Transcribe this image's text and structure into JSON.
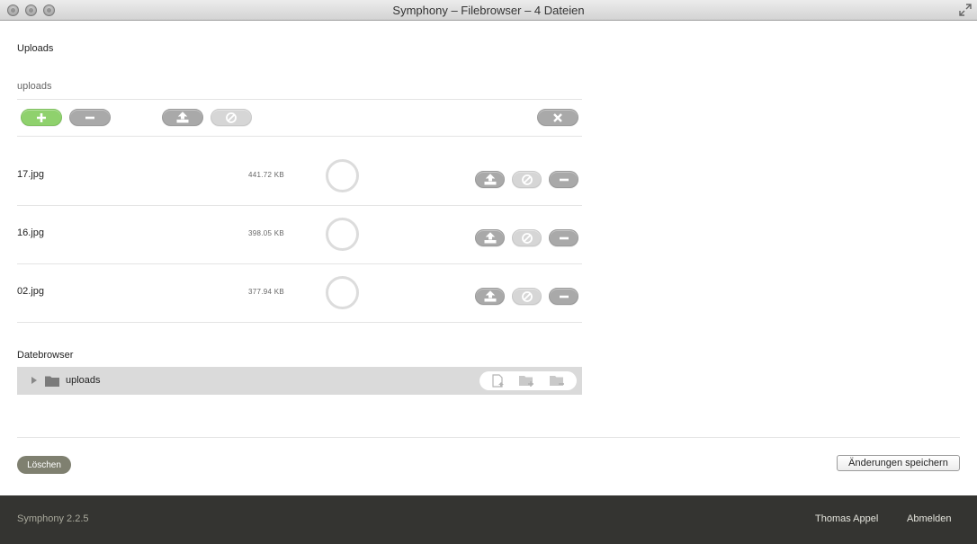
{
  "window": {
    "title": "Symphony – Filebrowser – 4 Dateien"
  },
  "uploads": {
    "section_title": "Uploads",
    "field_label": "uploads",
    "toolbar": {
      "add_icon": "plus-icon",
      "remove_icon": "minus-icon",
      "upload_icon": "upload-icon",
      "cancel_icon": "cancel-icon",
      "clear_icon": "close-icon"
    },
    "files": [
      {
        "name": "17.jpg",
        "size": "441.72 KB"
      },
      {
        "name": "16.jpg",
        "size": "398.05 KB"
      },
      {
        "name": "02.jpg",
        "size": "377.94 KB"
      }
    ]
  },
  "browser": {
    "section_title": "Datebrowser",
    "root_folder": "uploads"
  },
  "actions": {
    "delete_label": "Löschen",
    "save_label": "Änderungen speichern"
  },
  "footer": {
    "version": "Symphony 2.2.5",
    "user": "Thomas Appel",
    "logout": "Abmelden"
  },
  "colors": {
    "add_button": "#8fd16d",
    "footer_bg": "#343431",
    "delete_button": "#7f8070"
  }
}
